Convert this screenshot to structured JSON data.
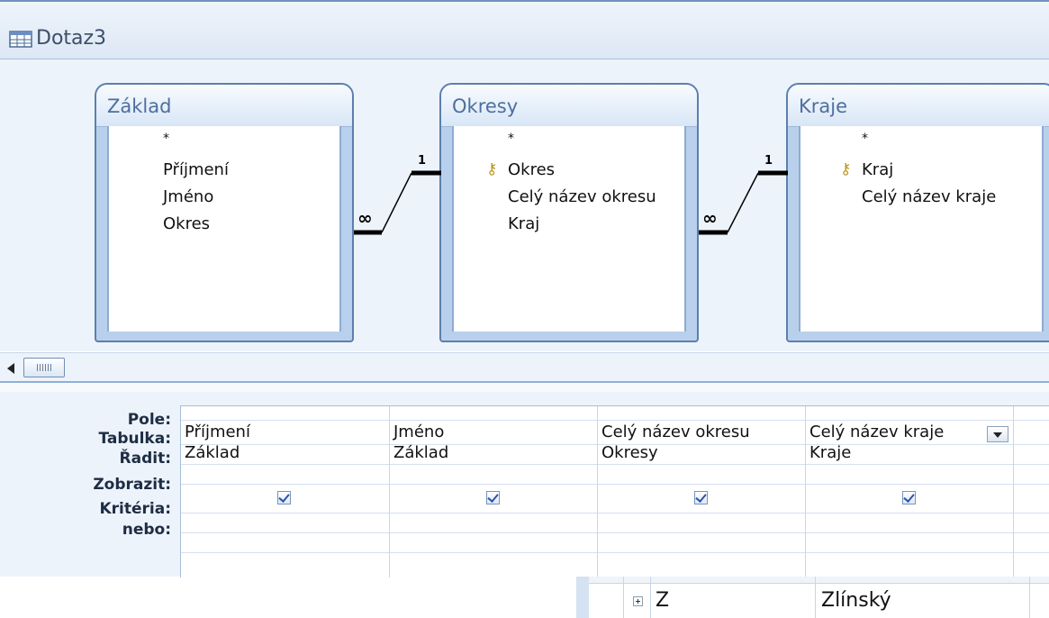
{
  "window": {
    "title": "Dotaz3",
    "icon": "query-icon"
  },
  "tables": [
    {
      "title": "Základ",
      "fields": [
        {
          "name": "*",
          "key": false
        },
        {
          "name": "Příjmení",
          "key": false
        },
        {
          "name": "Jméno",
          "key": false
        },
        {
          "name": "Okres",
          "key": false
        }
      ]
    },
    {
      "title": "Okresy",
      "fields": [
        {
          "name": "*",
          "key": false
        },
        {
          "name": "Okres",
          "key": true
        },
        {
          "name": "Celý název okresu",
          "key": false
        },
        {
          "name": "Kraj",
          "key": false
        }
      ]
    },
    {
      "title": "Kraje",
      "fields": [
        {
          "name": "*",
          "key": false
        },
        {
          "name": "Kraj",
          "key": true
        },
        {
          "name": "Celý název kraje",
          "key": false
        }
      ]
    }
  ],
  "relationships": [
    {
      "from": "Základ.Okres",
      "to": "Okresy.Okres",
      "many_label": "∞",
      "one_label": "1"
    },
    {
      "from": "Okresy.Kraj",
      "to": "Kraje.Kraj",
      "many_label": "∞",
      "one_label": "1"
    }
  ],
  "grid": {
    "row_labels": {
      "pole": "Pole:",
      "tabulka": "Tabulka:",
      "radit": "Řadit:",
      "zobrazit": "Zobrazit:",
      "kriteria": "Kritéria:",
      "nebo": "nebo:"
    },
    "columns": [
      {
        "pole": "Příjmení",
        "tabulka": "Základ",
        "show": true
      },
      {
        "pole": "Jméno",
        "tabulka": "Základ",
        "show": true
      },
      {
        "pole": "Celý název okresu",
        "tabulka": "Okresy",
        "show": true
      },
      {
        "pole": "Celý název kraje",
        "tabulka": "Kraje",
        "show": true
      }
    ]
  },
  "overlay_row": {
    "code": "Z",
    "name": "Zlínský"
  }
}
